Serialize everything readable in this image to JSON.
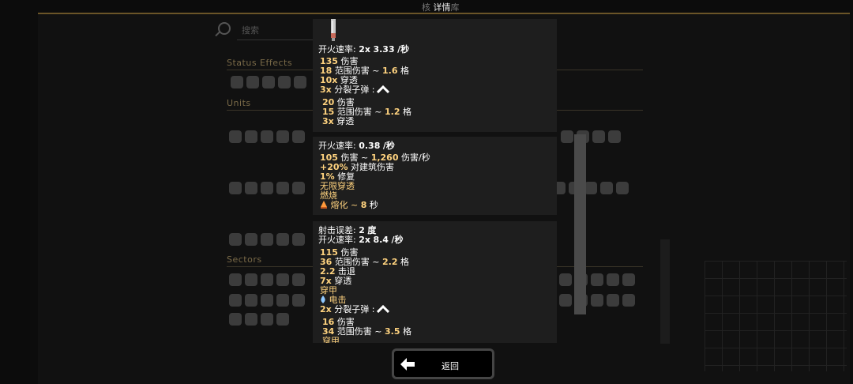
{
  "background": {
    "title_left": "核",
    "title_center": "详情",
    "title_right": "库",
    "search_placeholder": "搜索",
    "section_status": "Status Effects",
    "section_units": "Units",
    "section_sectors": "Sectors"
  },
  "card1": {
    "fire_rate_label": "开火速率:",
    "fire_rate_mult": "2x",
    "fire_rate_value": "3.33",
    "fire_rate_unit": "/秒",
    "damage_value": "135",
    "damage_label": "伤害",
    "splash_value": "18",
    "splash_label": "范围伤害 ~",
    "splash_radius": "1.6",
    "splash_unit": "格",
    "pierce_value": "10x",
    "pierce_label": "穿透",
    "frag_count": "3x",
    "frag_label": "分裂子弹 :",
    "frag_damage_value": "20",
    "frag_damage_label": "伤害",
    "frag_splash_value": "15",
    "frag_splash_label": "范围伤害 ~",
    "frag_splash_radius": "1.2",
    "frag_splash_unit": "格",
    "frag_pierce_value": "3x",
    "frag_pierce_label": "穿透"
  },
  "card2": {
    "fire_rate_label": "开火速率:",
    "fire_rate_value": "0.38",
    "fire_rate_unit": "/秒",
    "damage_value": "105",
    "damage_sep": "伤害 ~",
    "dps_value": "1,260",
    "dps_label": "伤害/秒",
    "building_value": "+20%",
    "building_label": "对建筑伤害",
    "repair_value": "1%",
    "repair_label": "修复",
    "pierce_infinite": "无限穿透",
    "burning": "燃烧",
    "melting_label": "熔化 ~",
    "melting_value": "8",
    "melting_unit": "秒"
  },
  "card3": {
    "inaccuracy_label": "射击误差:",
    "inaccuracy_value": "2",
    "inaccuracy_unit": "度",
    "fire_rate_label": "开火速率:",
    "fire_rate_mult": "2x",
    "fire_rate_value": "8.4",
    "fire_rate_unit": "/秒",
    "damage_value": "115",
    "damage_label": "伤害",
    "splash_value": "36",
    "splash_label": "范围伤害 ~",
    "splash_radius": "2.2",
    "splash_unit": "格",
    "knockback_value": "2.2",
    "knockback_label": "击退",
    "pierce_value": "7x",
    "pierce_label": "穿透",
    "armor_pierce": "穿甲",
    "shocked": "电击",
    "frag_count": "2x",
    "frag_label": "分裂子弹 :",
    "frag_damage_value": "16",
    "frag_damage_label": "伤害",
    "frag_splash_value": "34",
    "frag_splash_label": "范围伤害 ~",
    "frag_splash_radius": "3.5",
    "frag_splash_unit": "格",
    "frag_armor_pierce": "穿甲"
  },
  "back_button": {
    "label": "返回",
    "icon": "arrow-left-icon"
  },
  "colors": {
    "accent": "#ffd37f",
    "panel": "#1e1e1e",
    "shocked_icon": "#8fc8ff",
    "melting_icon": "#ff9a3c"
  }
}
